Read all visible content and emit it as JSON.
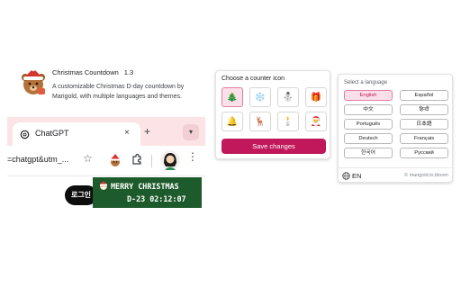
{
  "extension": {
    "name": "Christmas Countdown",
    "version": "1.3",
    "description": "A customizable Christmas D-day countdown by Marigold, with multiple languages and themes."
  },
  "browser": {
    "tab_title": "ChatGPT",
    "tab_close": "×",
    "new_tab": "+",
    "tab_dropdown": "▾",
    "url_fragment": "=chatgpt&utm_...",
    "star": "☆",
    "kebab": "⋮",
    "login_button": "로그인"
  },
  "tooltip": {
    "line1": "MERRY CHRISTMAS",
    "line2": "D-23 02:12:07",
    "bg_color": "#1e5b2c"
  },
  "icon_picker": {
    "title": "Choose a counter icon",
    "icons": [
      {
        "name": "christmas-tree-icon",
        "glyph": "🎄",
        "selected": true
      },
      {
        "name": "snowflake-icon",
        "glyph": "❄️",
        "selected": false
      },
      {
        "name": "snowman-icon",
        "glyph": "⛄",
        "selected": false
      },
      {
        "name": "gift-icon",
        "glyph": "🎁",
        "selected": false
      },
      {
        "name": "bell-icon",
        "glyph": "🔔",
        "selected": false
      },
      {
        "name": "reindeer-icon",
        "glyph": "🦌",
        "selected": false
      },
      {
        "name": "candle-icon",
        "glyph": "🕯️",
        "selected": false
      },
      {
        "name": "santa-icon",
        "glyph": "🎅",
        "selected": false
      }
    ],
    "save_label": "Save changes",
    "accent_color": "#c0185a"
  },
  "language_picker": {
    "title": "Select a language",
    "languages": [
      {
        "label": "English",
        "selected": true
      },
      {
        "label": "Español",
        "selected": false
      },
      {
        "label": "中文",
        "selected": false
      },
      {
        "label": "हिन्दी",
        "selected": false
      },
      {
        "label": "Português",
        "selected": false
      },
      {
        "label": "日本語",
        "selected": false
      },
      {
        "label": "Deutsch",
        "selected": false
      },
      {
        "label": "Français",
        "selected": false
      },
      {
        "label": "한국어",
        "selected": false
      },
      {
        "label": "Русский",
        "selected": false
      }
    ],
    "current": "EN",
    "copyright": "© marigold.in.bloom"
  }
}
